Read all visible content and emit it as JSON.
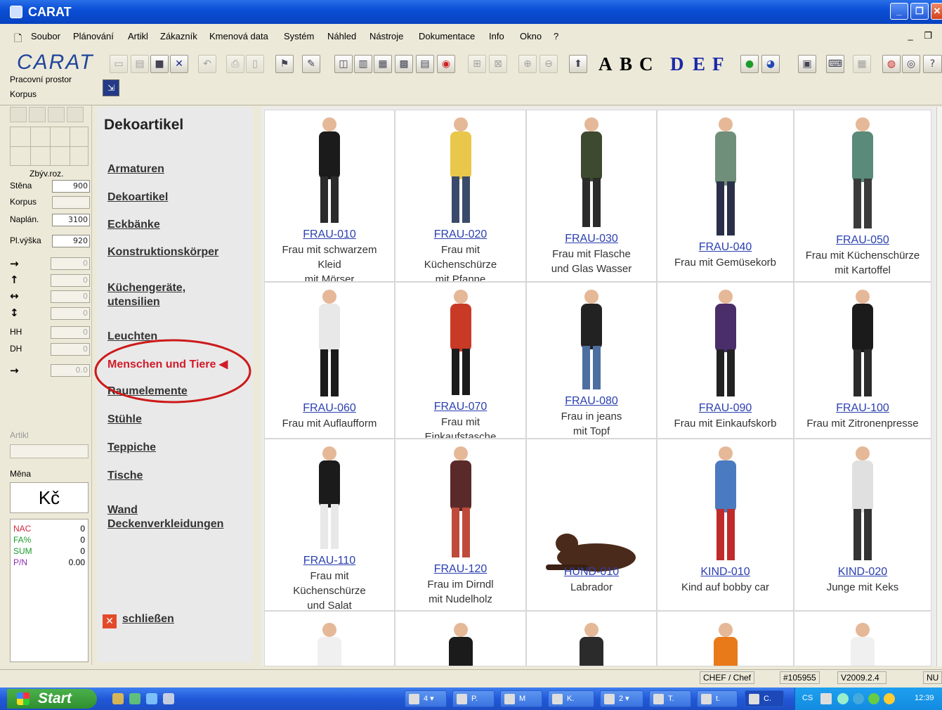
{
  "window": {
    "title": "CARAT"
  },
  "menu": [
    "Soubor",
    "Plánování",
    "Artikl",
    "Zákazník",
    "Kmenová data",
    "Systém",
    "Náhled",
    "Nástroje",
    "Dokumentace",
    "Info",
    "Okno",
    "?"
  ],
  "app_logo": "CARAT",
  "toolbar_letters": [
    "A",
    "B",
    "C",
    "D",
    "E",
    "F"
  ],
  "left": {
    "workspace_label": "Pracovní prostor",
    "korpus_label": "Korpus",
    "remaining_label": "Zbýv.roz.",
    "rows": [
      {
        "label": "Stěna",
        "color": "#1c2ea8",
        "value": "900"
      },
      {
        "label": "Korpus",
        "color": "#d0263a",
        "value": ""
      },
      {
        "label": "Naplán.",
        "color": "#1a9b2a",
        "value": "3100"
      },
      {
        "label": "Pl.výška",
        "color": "#000000",
        "value": "920"
      }
    ],
    "inputs": [
      {
        "label": "→",
        "value": "0"
      },
      {
        "label": "↑",
        "value": "0"
      },
      {
        "label": "↔",
        "value": "0"
      },
      {
        "label": "↕",
        "value": "0"
      },
      {
        "label": "HH",
        "value": "0"
      },
      {
        "label": "DH",
        "value": "0"
      },
      {
        "label": "→",
        "value": "0.0"
      }
    ],
    "article_label": "Artikl",
    "currency_label": "Měna",
    "currency_value": "Kč",
    "sums": [
      {
        "label": "NAC",
        "color": "#d0263a",
        "value": "0"
      },
      {
        "label": "FA%",
        "color": "#1a9b2a",
        "value": "0"
      },
      {
        "label": "SUM",
        "color": "#1a9b2a",
        "value": "0"
      },
      {
        "label": "P/N",
        "color": "#8a2bb0",
        "value": "0.00"
      }
    ]
  },
  "catalog": {
    "title": "Dekoartikel",
    "categories": [
      "Armaturen",
      "Dekoartikel",
      "Eckbänke",
      "Konstruktionskörper",
      "Küchengeräte, utensilien",
      "Leuchten",
      "Menschen und Tiere",
      "Raumelemente",
      "Stühle",
      "Teppiche",
      "Tische",
      "Wand Deckenverkleidungen"
    ],
    "active_index": 6,
    "active_marker": "◀",
    "close_label": "schließen"
  },
  "items": [
    {
      "code": "FRAU-010",
      "desc": "Frau mit schwarzem\nKleid\nmit Mörser"
    },
    {
      "code": "FRAU-020",
      "desc": "Frau mit\nKüchenschürze\nmit Pfanne"
    },
    {
      "code": "FRAU-030",
      "desc": "Frau mit Flasche\nund Glas Wasser"
    },
    {
      "code": "FRAU-040",
      "desc": "Frau mit Gemüsekorb"
    },
    {
      "code": "FRAU-050",
      "desc": "Frau mit Küchenschürze\nmit Kartoffel"
    },
    {
      "code": "FRAU-060",
      "desc": "Frau mit Auflaufform"
    },
    {
      "code": "FRAU-070",
      "desc": "Frau mit\nEinkaufstasche"
    },
    {
      "code": "FRAU-080",
      "desc": "Frau in jeans\nmit Topf"
    },
    {
      "code": "FRAU-090",
      "desc": "Frau mit Einkaufskorb"
    },
    {
      "code": "FRAU-100",
      "desc": "Frau mit Zitronenpresse"
    },
    {
      "code": "FRAU-110",
      "desc": "Frau mit\nKüchenschürze\nund Salat"
    },
    {
      "code": "FRAU-120",
      "desc": "Frau im Dirndl\nmit Nudelholz"
    },
    {
      "code": "HUND-010",
      "desc": "Labrador"
    },
    {
      "code": "KIND-010",
      "desc": "Kind auf bobby car"
    },
    {
      "code": "KIND-020",
      "desc": "Junge mit Keks"
    }
  ],
  "status": {
    "user": "CHEF / Chef",
    "id": "#105955",
    "version": "V2009.2.4",
    "mode": "NU"
  },
  "taskbar": {
    "start": "Start",
    "tasks": [
      "4 ▾",
      "P.",
      "M",
      "K.",
      "2 ▾",
      "T.",
      "t.",
      "C."
    ],
    "lang": "CS",
    "clock": "12:39"
  }
}
